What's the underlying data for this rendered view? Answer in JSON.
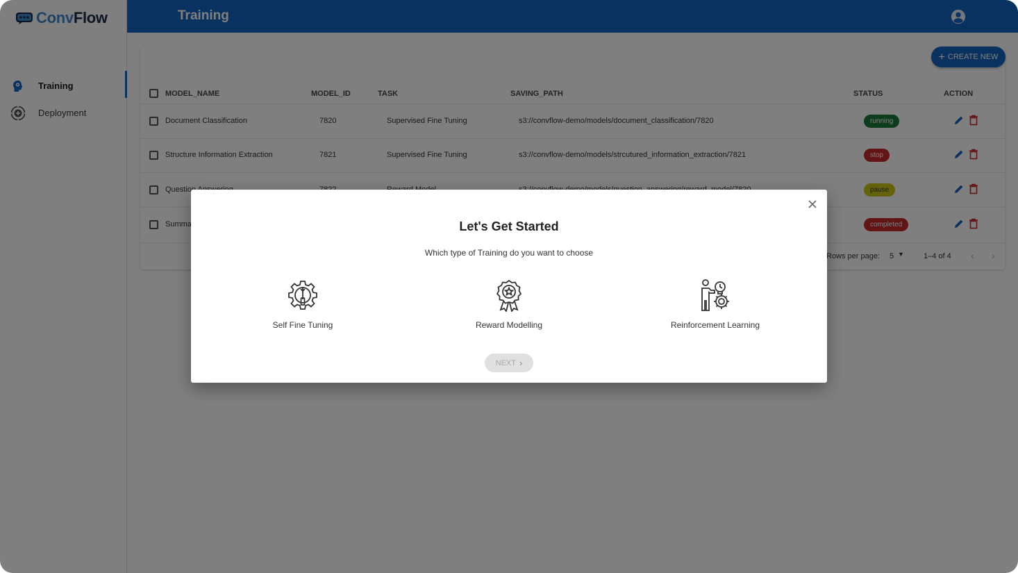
{
  "app": {
    "logo_part1": "Conv",
    "logo_part2": "Flow"
  },
  "sidebar": {
    "items": [
      {
        "label": "Training",
        "icon": "brain-head-icon",
        "active": true
      },
      {
        "label": "Deployment",
        "icon": "circle-plus-icon",
        "active": false
      }
    ]
  },
  "header": {
    "title": "Training",
    "account_icon": "account-circle-icon"
  },
  "toolbar": {
    "create_label": "CREATE NEW"
  },
  "table": {
    "columns": [
      "MODEL_NAME",
      "MODEL_ID",
      "TASK",
      "SAVING_PATH",
      "STATUS",
      "ACTION"
    ],
    "rows": [
      {
        "name": "Document Classification",
        "id": "7820",
        "task": "Supervised Fine Tuning",
        "path": "s3://convflow-demo/models/document_classification/7820",
        "status": "running"
      },
      {
        "name": "Structure Information Extraction",
        "id": "7821",
        "task": "Supervised Fine Tuning",
        "path": "s3://convflow-demo/models/strcutured_information_extraction/7821",
        "status": "stop"
      },
      {
        "name": "Question Answering",
        "id": "7822",
        "task": "Reward Model",
        "path": "s3://convflow-demo/models/question_answering/reward_model/7820",
        "status": "pause"
      },
      {
        "name": "Summa",
        "id": "",
        "task": "",
        "path": "",
        "status": "completed"
      }
    ],
    "status_colors": {
      "running": "#1b7a3a",
      "stop": "#c62828",
      "pause": "#c8c415",
      "completed": "#c62828"
    }
  },
  "pagination": {
    "rows_per_page_label": "Rows per page:",
    "rows_per_page_value": "5",
    "range": "1–4 of 4"
  },
  "dialog": {
    "title": "Let's Get Started",
    "subtitle": "Which type of Training do you want to choose",
    "options": [
      {
        "label": "Self Fine Tuning",
        "icon": "gear-wrench-icon"
      },
      {
        "label": "Reward Modelling",
        "icon": "award-badge-icon"
      },
      {
        "label": "Reinforcement Learning",
        "icon": "person-gears-icon"
      }
    ],
    "next_label": "NEXT"
  },
  "colors": {
    "primary": "#1565c0",
    "logo_conv": "#3d86c6",
    "logo_flow": "#1a2b4a",
    "action_edit": "#1565c0",
    "action_delete": "#c62828"
  }
}
